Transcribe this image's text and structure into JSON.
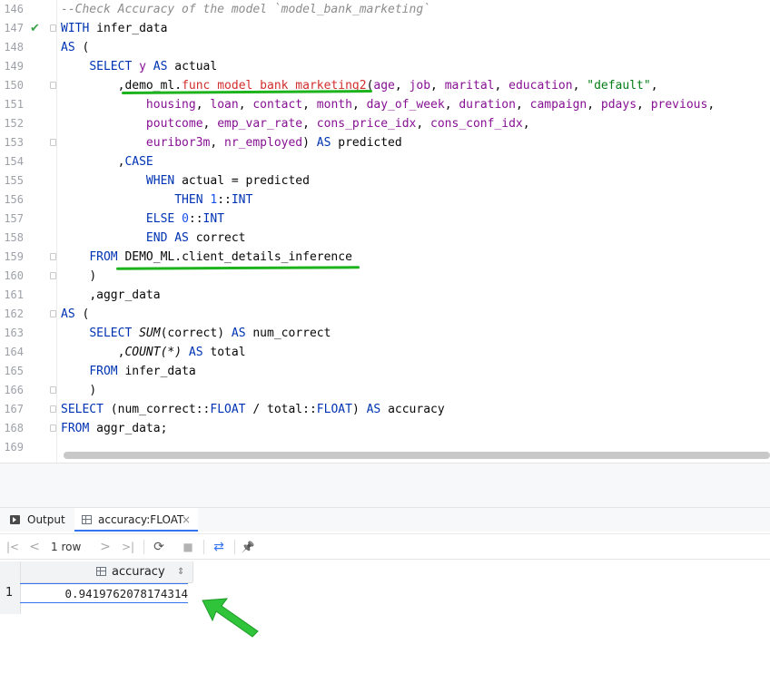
{
  "editor": {
    "line_numbers": [
      "146",
      "147",
      "148",
      "149",
      "150",
      "151",
      "152",
      "153",
      "154",
      "155",
      "156",
      "157",
      "158",
      "159",
      "160",
      "161",
      "162",
      "163",
      "164",
      "165",
      "166",
      "167",
      "168",
      "169"
    ],
    "l146": {
      "comment": "--Check Accuracy of the model `model_bank_marketing`"
    },
    "l147": {
      "kw": "WITH",
      "name": "infer_data"
    },
    "l148": {
      "kw": "AS",
      "paren": "("
    },
    "l149": {
      "kw1": "SELECT",
      "col": "y",
      "kw2": "AS",
      "alias": "actual"
    },
    "l150": {
      "comma": ",",
      "schema": "demo_ml",
      "dot": ".",
      "func": "func_model_bank_marketing2",
      "open": "(",
      "cols": [
        "age",
        "job",
        "marital",
        "education"
      ],
      "str": "\"default\"",
      "trail": ","
    },
    "l151": {
      "cols": [
        "housing",
        "loan",
        "contact",
        "month",
        "day_of_week",
        "duration",
        "campaign",
        "pdays",
        "previous"
      ],
      "trail": ","
    },
    "l152": {
      "cols": [
        "poutcome",
        "emp_var_rate",
        "cons_price_idx",
        "cons_conf_idx"
      ],
      "trail": ","
    },
    "l153": {
      "cols": [
        "euribor3m",
        "nr_employed"
      ],
      "close": ")",
      "kw": "AS",
      "alias": "predicted"
    },
    "l154": {
      "comma": ",",
      "kw": "CASE"
    },
    "l155": {
      "kw": "WHEN",
      "expr": "actual = predicted"
    },
    "l156": {
      "kw": "THEN",
      "num": "1",
      "cast": "::",
      "type": "INT"
    },
    "l157": {
      "kw": "ELSE",
      "num": "0",
      "cast": "::",
      "type": "INT"
    },
    "l158": {
      "kw1": "END",
      "kw2": "AS",
      "alias": "correct"
    },
    "l159": {
      "kw": "FROM",
      "table": "DEMO_ML.client_details_inference"
    },
    "l160": {
      "paren": ")"
    },
    "l161": {
      "text": ",aggr_data"
    },
    "l162": {
      "kw": "AS",
      "paren": "("
    },
    "l163": {
      "kw1": "SELECT",
      "func": "SUM",
      "arg": "(correct)",
      "kw2": "AS",
      "alias": "num_correct"
    },
    "l164": {
      "comma": ",",
      "func": "COUNT",
      "arg": "(*)",
      "kw": "AS",
      "alias": "total"
    },
    "l165": {
      "kw": "FROM",
      "name": "infer_data"
    },
    "l166": {
      "paren": ")"
    },
    "l167": {
      "kw1": "SELECT",
      "open": "(num_correct::",
      "type1": "FLOAT",
      "mid": " / total::",
      "type2": "FLOAT",
      "close": ")",
      "kw2": "AS",
      "alias": "accuracy"
    },
    "l168": {
      "kw": "FROM",
      "rest": "aggr_data;"
    }
  },
  "tabs": {
    "output": "Output",
    "result": "accuracy:FLOAT",
    "close": "×"
  },
  "toolbar": {
    "first": "|<",
    "prev": "<",
    "rows": "1 row",
    "rows_caret": "⌄",
    "next": ">",
    "last": ">|",
    "refresh": "⟳",
    "stop": "■",
    "compare": "⇄",
    "pin": "📌"
  },
  "grid": {
    "column": "accuracy",
    "sort_icon": "⇕",
    "row_number": "1",
    "value": "0.9419762078174314"
  },
  "colors": {
    "keyword": "#0033b3",
    "column": "#871094",
    "string": "#067d17",
    "number": "#1750eb",
    "highlight_func": "#d22d2d",
    "annotation_green": "#1db31d"
  }
}
